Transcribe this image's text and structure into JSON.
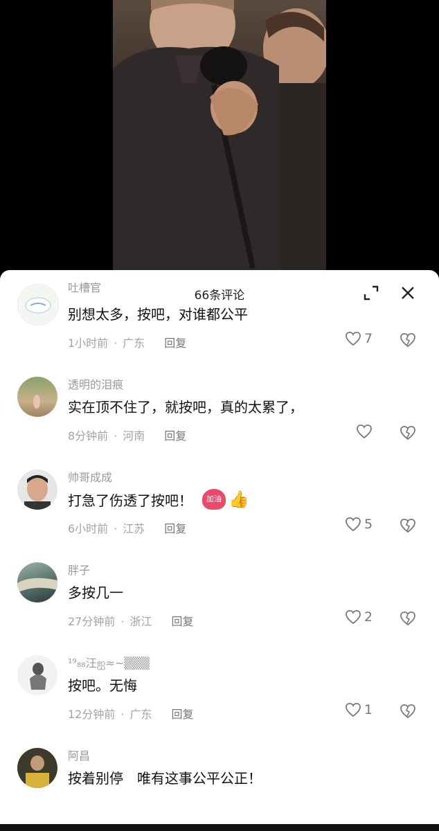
{
  "sheet": {
    "title": "66条评论"
  },
  "comments": [
    {
      "user": "吐槽官",
      "text": "别想太多，按吧，对谁都公平",
      "time": "1小时前",
      "region": "广东",
      "reply": "回复",
      "likes": "7"
    },
    {
      "user": "透明的泪痕",
      "text": "实在顶不住了，就按吧，真的太累了，",
      "time": "8分钟前",
      "region": "河南",
      "reply": "回复",
      "likes": ""
    },
    {
      "user": "帅哥成成",
      "text": "打急了伤透了按吧！",
      "emoji1": "加油",
      "emoji2": "👍",
      "time": "6小时前",
      "region": "江苏",
      "reply": "回复",
      "likes": "5"
    },
    {
      "user": "胖子",
      "text": "多按几一",
      "time": "27分钟前",
      "region": "浙江",
      "reply": "回复",
      "likes": "2"
    },
    {
      "user": "¹⁹₈₈汪ஐ≈~▒▒▒",
      "text": "按吧。无悔",
      "time": "12分钟前",
      "region": "广东",
      "reply": "回复",
      "likes": "1"
    },
    {
      "user": "阿昌",
      "text": "按着别停　唯有这事公平公正！",
      "time": "",
      "region": "",
      "reply": "",
      "likes": ""
    }
  ],
  "icons": {
    "expand": "expand-icon",
    "close": "close-icon",
    "like": "heart-icon",
    "dislike": "broken-heart-icon"
  }
}
